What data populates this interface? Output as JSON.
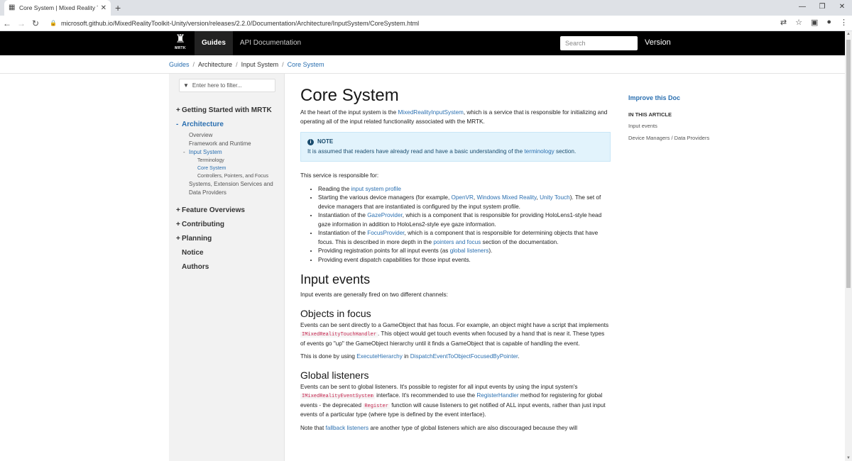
{
  "browser": {
    "tab_title": "Core System | Mixed Reality Tooli",
    "url": "microsoft.github.io/MixedRealityToolkit-Unity/version/releases/2.2.0/Documentation/Architecture/InputSystem/CoreSystem.html"
  },
  "header": {
    "logo_text": "MRTK",
    "nav": [
      "Guides",
      "API Documentation"
    ],
    "search_placeholder": "Search",
    "version_label": "Version"
  },
  "breadcrumb": [
    "Guides",
    "Architecture",
    "Input System",
    "Core System"
  ],
  "sidebar": {
    "filter_placeholder": "Enter here to filter...",
    "getting_started": "Getting Started with MRTK",
    "architecture": "Architecture",
    "overview": "Overview",
    "framework": "Framework and Runtime",
    "input_system": "Input System",
    "terminology": "Terminology",
    "core_system": "Core System",
    "controllers": "Controllers, Pointers, and Focus",
    "systems": "Systems, Extension Services and Data Providers",
    "feature_overviews": "Feature Overviews",
    "contributing": "Contributing",
    "planning": "Planning",
    "notice": "Notice",
    "authors": "Authors"
  },
  "article": {
    "title": "Core System",
    "intro_pre": "At the heart of the input system is the ",
    "intro_link": "MixedRealityInputSystem",
    "intro_post": ", which is a service that is responsible for initializing and operating all of the input related functionality associated with the MRTK.",
    "note_title": "NOTE",
    "note_pre": "It is assumed that readers have already read and have a basic understanding of the ",
    "note_link": "terminology",
    "note_post": " section.",
    "responsible": "This service is responsible for:",
    "b1_pre": "Reading the ",
    "b1_link": "input system profile",
    "b2_pre": "Starting the various device managers (for example, ",
    "b2_link1": "OpenVR",
    "b2_sep1": ", ",
    "b2_link2": "Windows Mixed Reality",
    "b2_sep2": ", ",
    "b2_link3": "Unity Touch",
    "b2_post": "). The set of device managers that are instantiated is configured by the input system profile.",
    "b3_pre": "Instantiation of the ",
    "b3_link": "GazeProvider",
    "b3_post": ", which is a component that is responsible for providing HoloLens1-style head gaze information in addition to HoloLens2-style eye gaze information.",
    "b4_pre": "Instantiation of the ",
    "b4_link": "FocusProvider",
    "b4_mid": ", which is a component that is responsible for determining objects that have focus. This is described in more depth in the ",
    "b4_link2": "pointers and focus",
    "b4_post": " section of the documentation.",
    "b5_pre": "Providing registration points for all input events (as ",
    "b5_link": "global listeners",
    "b5_post": ").",
    "b6": "Providing event dispatch capabilities for those input events.",
    "h_input_events": "Input events",
    "input_events_p": "Input events are generally fired on two different channels:",
    "h_objects": "Objects in focus",
    "obj_p1_pre": "Events can be sent directly to a GameObject that has focus. For example, an object might have a script that implements ",
    "obj_code": "IMixedRealityTouchHandler",
    "obj_p1_post": ". This object would get touch events when focused by a hand that is near it. These types of events go \"up\" the GameObject hierarchy until it finds a GameObject that is capable of handling the event.",
    "obj_p2_pre": "This is done by using ",
    "obj_p2_link1": "ExecuteHierarchy",
    "obj_p2_mid": " in ",
    "obj_p2_link2": "DispatchEventToObjectFocusedByPointer",
    "obj_p2_post": ".",
    "h_global": "Global listeners",
    "gl_p1_pre": "Events can be sent to global listeners. It's possible to register for all input events by using the input system's ",
    "gl_code1": "IMixedRealityEventSystem",
    "gl_p1_mid": " interface. It's recommended to use the ",
    "gl_link": "RegisterHandler",
    "gl_p1_mid2": " method for registering for global events - the deprecated ",
    "gl_code2": "Register",
    "gl_p1_post": " function will cause listeners to get notified of ALL input events, rather than just input events of a particular type (where type is defined by the event interface).",
    "gl_p2_pre": "Note that ",
    "gl_p2_link": "fallback listeners",
    "gl_p2_post": " are another type of global listeners which are also discouraged because they will"
  },
  "right": {
    "improve": "Improve this Doc",
    "in_this_article": "IN THIS ARTICLE",
    "links": [
      "Input events",
      "Device Managers / Data Providers"
    ]
  },
  "colors": {
    "link": "#2a6fb0",
    "header_bg": "#000000",
    "note_bg": "#e2f3fc"
  }
}
